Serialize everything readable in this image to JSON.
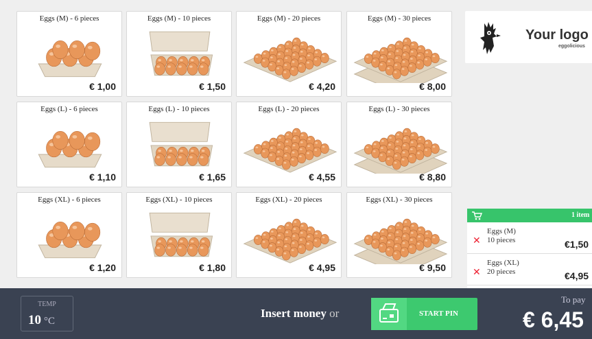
{
  "products": [
    {
      "name": "Eggs (M) - 6 pieces",
      "price": "€ 1,00",
      "pack": "carton-6"
    },
    {
      "name": "Eggs (M) - 10 pieces",
      "price": "€ 1,50",
      "pack": "carton-10"
    },
    {
      "name": "Eggs (M) - 20 pieces",
      "price": "€ 4,20",
      "pack": "tray-20"
    },
    {
      "name": "Eggs (M) - 30 pieces",
      "price": "€ 8,00",
      "pack": "tray-30"
    },
    {
      "name": "Eggs (L) - 6 pieces",
      "price": "€ 1,10",
      "pack": "carton-6"
    },
    {
      "name": "Eggs (L) - 10 pieces",
      "price": "€ 1,65",
      "pack": "carton-10"
    },
    {
      "name": "Eggs (L) - 20 pieces",
      "price": "€ 4,55",
      "pack": "tray-20"
    },
    {
      "name": "Eggs (L) - 30 pieces",
      "price": "€ 8,80",
      "pack": "tray-30"
    },
    {
      "name": "Eggs (XL) - 6 pieces",
      "price": "€ 1,20",
      "pack": "carton-6"
    },
    {
      "name": "Eggs (XL) - 10 pieces",
      "price": "€ 1,80",
      "pack": "carton-10"
    },
    {
      "name": "Eggs (XL) - 20 pieces",
      "price": "€ 4,95",
      "pack": "tray-20"
    },
    {
      "name": "Eggs (XL) - 30 pieces",
      "price": "€ 9,50",
      "pack": "tray-30"
    }
  ],
  "logo": {
    "title": "Your logo",
    "subtitle": "eggolicious",
    "icon": "rooster-icon"
  },
  "cart": {
    "count_label": "1 item",
    "items": [
      {
        "line1": "Eggs (M)",
        "line2": "10 pieces",
        "price": "€1,50"
      },
      {
        "line1": "Eggs (XL)",
        "line2": "20 pieces",
        "price": "€4,95"
      }
    ]
  },
  "footer": {
    "temp_label": "TEMP",
    "temp_value": "10",
    "temp_unit": "°C",
    "insert_money": "Insert money",
    "or_text": " or",
    "pin_button": "START PIN",
    "to_pay_label": "To pay",
    "total": "€ 6,45"
  },
  "colors": {
    "accent": "#3dc96f",
    "footer_bg": "#3a4252",
    "remove": "#e23333",
    "egg": "#e8975a"
  }
}
